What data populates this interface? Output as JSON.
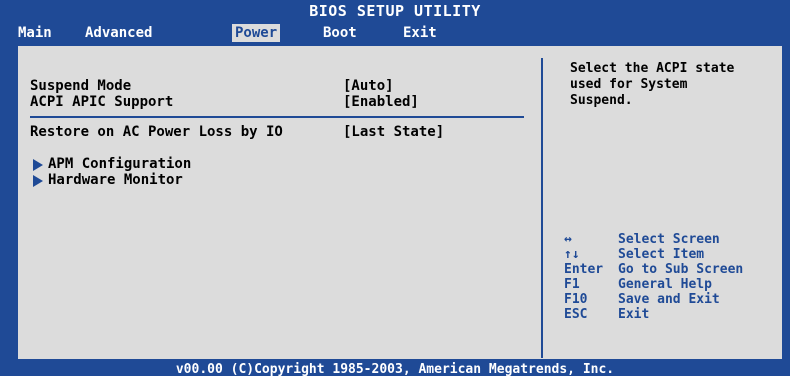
{
  "header": {
    "title": "BIOS SETUP UTILITY",
    "menu": [
      {
        "label": "Main",
        "active": false
      },
      {
        "label": "Advanced",
        "active": false
      },
      {
        "label": "Power",
        "active": true
      },
      {
        "label": "Boot",
        "active": false
      },
      {
        "label": "Exit",
        "active": false
      }
    ]
  },
  "settings": [
    {
      "label": "Suspend Mode",
      "value": "[Auto]"
    },
    {
      "label": "ACPI APIC Support",
      "value": "[Enabled]"
    },
    {
      "label": "Restore on AC Power Loss by IO",
      "value": "[Last State]"
    }
  ],
  "submenus": [
    {
      "label": "APM Configuration"
    },
    {
      "label": "Hardware Monitor"
    }
  ],
  "help": {
    "text": "Select the ACPI state\nused for System\nSuspend."
  },
  "keys": [
    {
      "key": "↔",
      "desc": "Select Screen"
    },
    {
      "key": "↑↓",
      "desc": "Select Item"
    },
    {
      "key": "Enter",
      "desc": "Go to Sub Screen"
    },
    {
      "key": "F1",
      "desc": "General Help"
    },
    {
      "key": "F10",
      "desc": "Save and Exit"
    },
    {
      "key": "ESC",
      "desc": "Exit"
    }
  ],
  "footer": {
    "copyright": "v00.00 (C)Copyright 1985-2003, American Megatrends, Inc."
  },
  "colors": {
    "bios_blue": "#1f4a96",
    "panel_gray": "#dcdcdc"
  }
}
